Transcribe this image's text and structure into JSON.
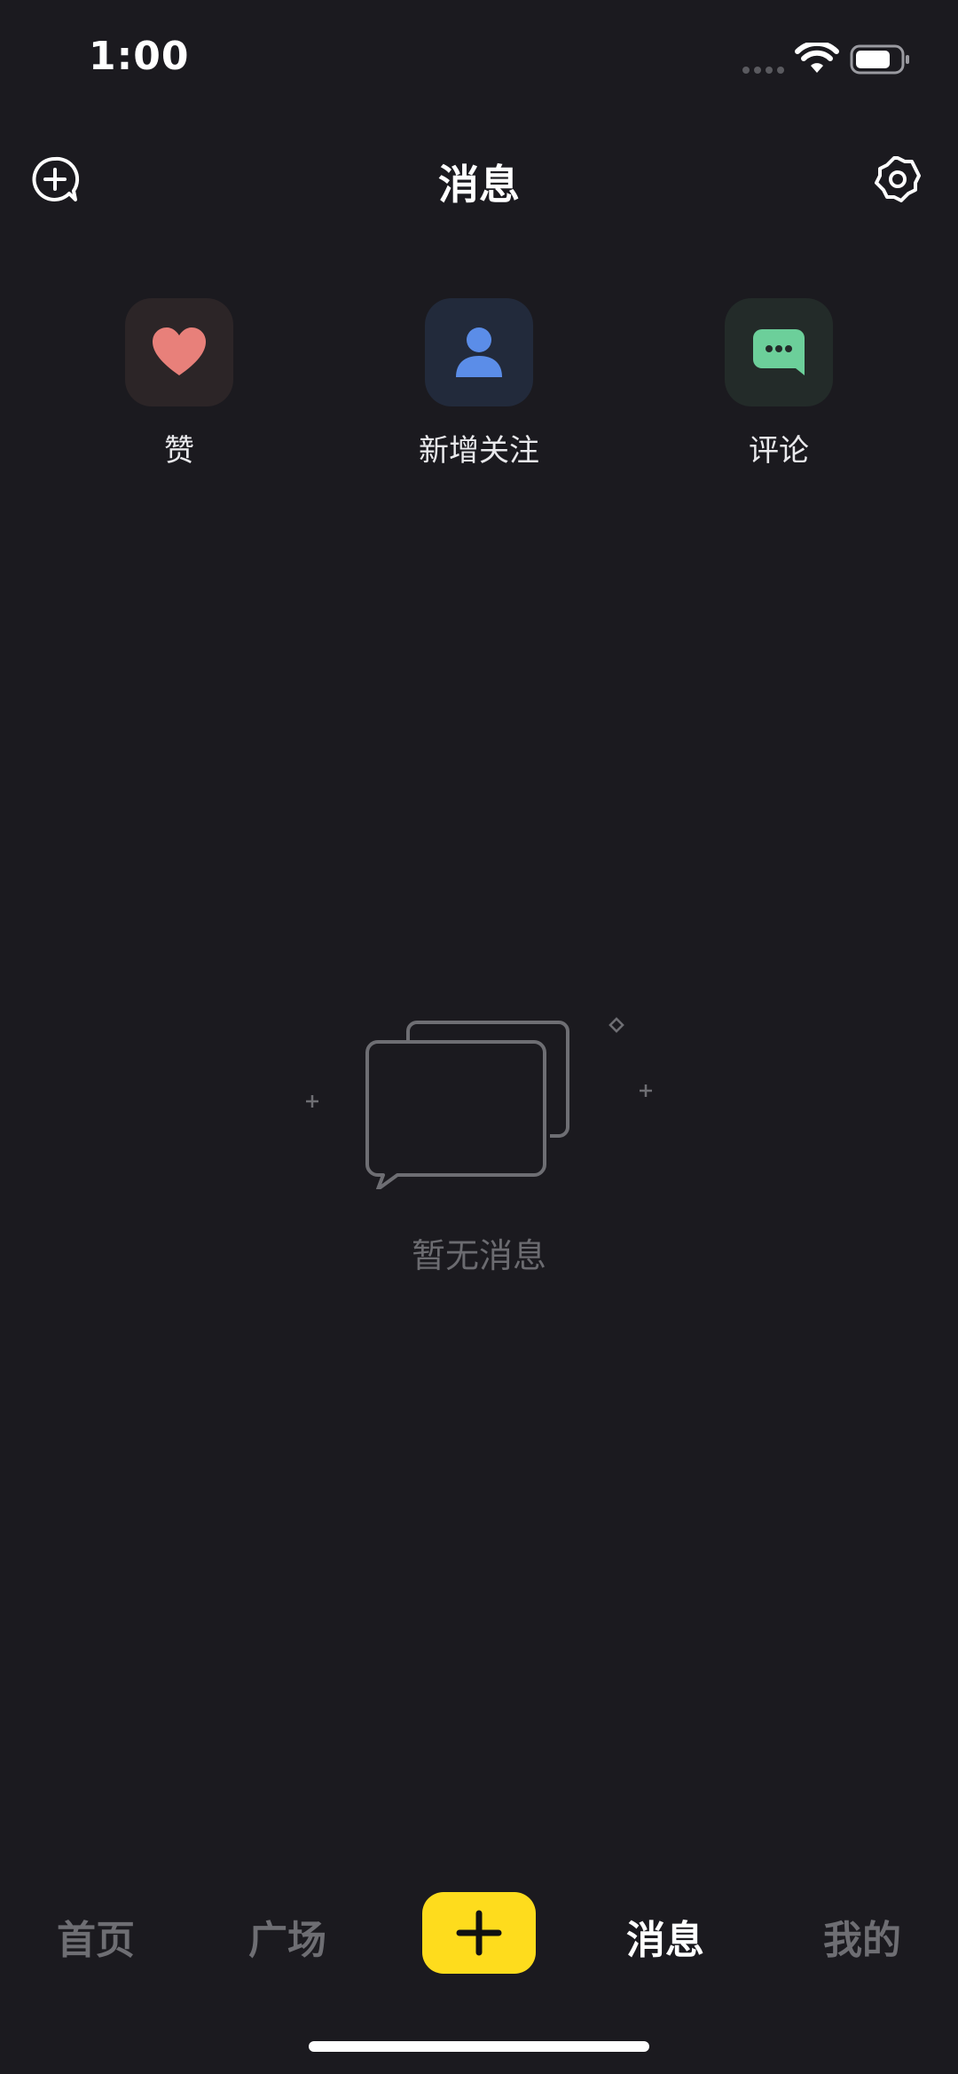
{
  "status_bar": {
    "time": "1:00"
  },
  "header": {
    "title": "消息",
    "left_icon": "add-chat-icon",
    "right_icon": "gear-icon"
  },
  "categories": [
    {
      "label": "赞",
      "icon": "heart-icon",
      "color": "#e8807a"
    },
    {
      "label": "新增关注",
      "icon": "person-icon",
      "color": "#5b8de8"
    },
    {
      "label": "评论",
      "icon": "comment-icon",
      "color": "#6ccf9a"
    }
  ],
  "empty_state": {
    "text": "暂无消息",
    "icon": "chat-bubbles-icon"
  },
  "bottom_nav": {
    "items": [
      {
        "label": "首页"
      },
      {
        "label": "广场"
      },
      {
        "label": "消息"
      },
      {
        "label": "我的"
      }
    ],
    "active": "消息",
    "add_icon": "plus-icon",
    "add_color": "#fedc1d"
  }
}
